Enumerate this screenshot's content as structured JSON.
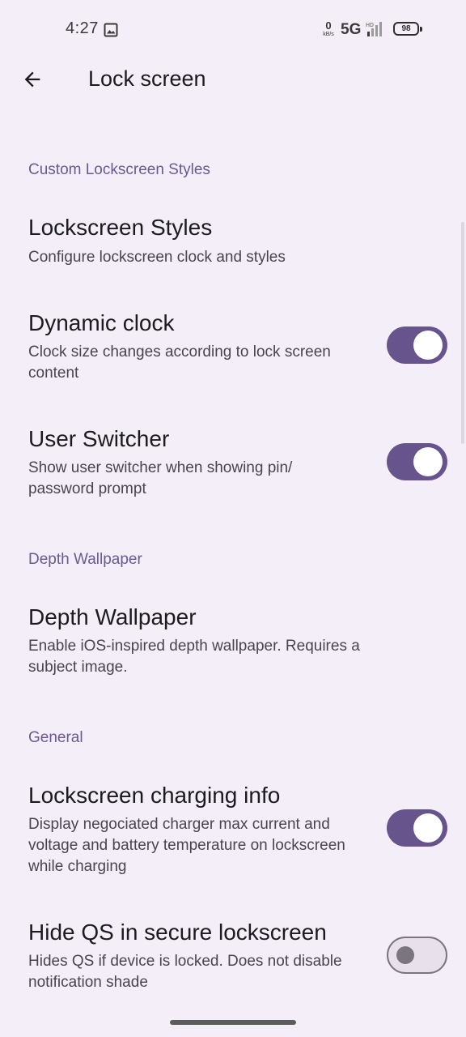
{
  "status_bar": {
    "time": "4:27",
    "net_speed_value": "0",
    "net_speed_unit": "kB/s",
    "network_type": "5G",
    "battery_level": "98",
    "icons": [
      "gallery-icon",
      "hd-signal-icon",
      "battery-icon"
    ]
  },
  "app_bar": {
    "title": "Lock screen",
    "back_icon": "arrow-back-icon"
  },
  "sections": {
    "custom": {
      "header": "Custom Lockscreen Styles",
      "lockscreen_styles": {
        "title": "Lockscreen Styles",
        "summary": "Configure lockscreen clock and styles"
      },
      "dynamic_clock": {
        "title": "Dynamic clock",
        "summary": "Clock size changes according to lock screen content",
        "enabled": true
      },
      "user_switcher": {
        "title": "User Switcher",
        "summary": "Show user switcher when showing pin/ password prompt",
        "enabled": true
      }
    },
    "depth": {
      "header": "Depth Wallpaper",
      "depth_wallpaper": {
        "title": "Depth Wallpaper",
        "summary": "Enable iOS-inspired depth wallpaper. Requires a subject image."
      }
    },
    "general": {
      "header": "General",
      "charging_info": {
        "title": "Lockscreen charging info",
        "summary": "Display negociated charger max current and voltage and battery temperature on lockscreen while charging",
        "enabled": true
      },
      "hide_qs": {
        "title": "Hide QS in secure lockscreen",
        "summary": "Hides QS if device is locked. Does not disable notification shade",
        "enabled": false
      }
    }
  },
  "colors": {
    "background": "#f3eef7",
    "accent": "#67548d",
    "section_header": "#6a5a93",
    "switch_off_track": "#e8e0ea",
    "switch_off_outline": "#7b757f"
  }
}
